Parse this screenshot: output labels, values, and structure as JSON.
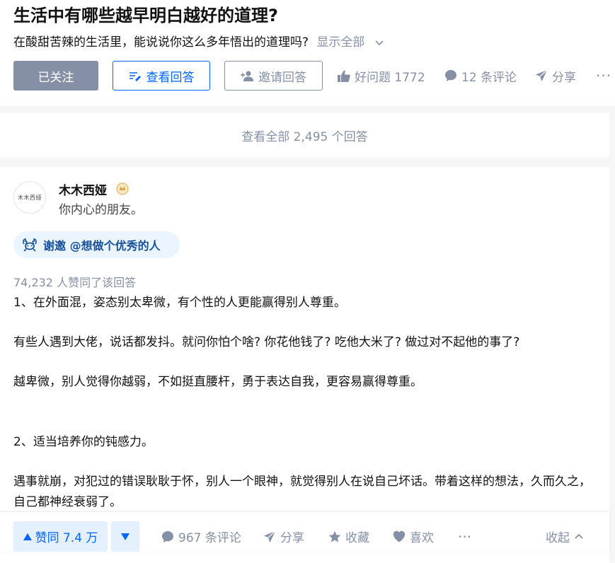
{
  "question": {
    "title": "生活中有哪些越早明白越好的道理?",
    "detail": "在酸甜苦辣的生活里，能说说你这么多年悟出的道理吗?",
    "show_all": "显示全部",
    "followed_label": "已关注",
    "view_answers_label": "查看回答",
    "invite_label": "邀请回答",
    "good_question_label": "好问题 1772",
    "comments_label": "12 条评论",
    "share_label": "分享",
    "more_label": "···"
  },
  "view_all": {
    "label": "查看全部 2,495 个回答"
  },
  "answer": {
    "author_name": "木木西娅",
    "author_bio": "你内心的朋友。",
    "avatar_text": "木木西娅",
    "invite_text": "谢邀 @想做个优秀的人",
    "votes_text": "74,232 人赞同了该回答",
    "paragraphs": [
      "1、在外面混，姿态别太卑微，有个性的人更能赢得别人尊重。",
      "有些人遇到大佬，说话都发抖。就问你怕个啥? 你花他钱了? 吃他大米了? 做过对不起他的事了?",
      "越卑微，别人觉得你越弱，不如挺直腰杆，勇于表达自我，更容易赢得尊重。",
      "2、适当培养你的钝感力。",
      "遇事就崩，对犯过的错误耿耿于怀，别人一个眼神，就觉得别人在说自己坏话。带着这样的想法，久而久之，自己都神经衰弱了。"
    ]
  },
  "action_bar": {
    "vote_up_label": "赞同 7.4 万",
    "comments_label": "967 条评论",
    "share_label": "分享",
    "collect_label": "收藏",
    "like_label": "喜欢",
    "more_label": "···",
    "collapse_label": "收起"
  },
  "colors": {
    "brand_blue": "#0066ff",
    "gray_text": "#8590a6",
    "followed_bg": "#8590a6",
    "vote_bg": "#e5f0ff",
    "invite_tag_bg": "#ebf5ff",
    "invite_tag_text": "#175199"
  }
}
